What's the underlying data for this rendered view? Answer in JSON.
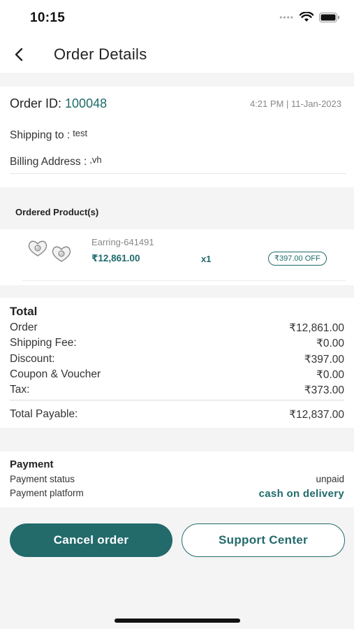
{
  "status_bar": {
    "time": "10:15"
  },
  "header": {
    "title": "Order Details"
  },
  "order": {
    "id_label": "Order ID:",
    "id_value": "100048",
    "datetime": "4:21 PM | 11-Jan-2023",
    "shipping_label": "Shipping to :",
    "shipping_value": "test",
    "billing_label": "Billing Address :",
    "billing_value": ",vh"
  },
  "products": {
    "section_label": "Ordered Product(s)",
    "items": [
      {
        "name": "Earring-641491",
        "price": "₹12,861.00",
        "qty": "x1",
        "discount_badge": "₹397.00 OFF"
      }
    ]
  },
  "totals": {
    "title": "Total",
    "rows": [
      {
        "label": "Order",
        "value": "₹12,861.00"
      },
      {
        "label": "Shipping Fee:",
        "value": "₹0.00"
      },
      {
        "label": "Discount:",
        "value": "₹397.00"
      },
      {
        "label": "Coupon & Voucher",
        "value": "₹0.00"
      },
      {
        "label": "Tax:",
        "value": "₹373.00"
      }
    ],
    "payable_label": "Total Payable:",
    "payable_value": "₹12,837.00"
  },
  "payment": {
    "title": "Payment",
    "status_label": "Payment status",
    "status_value": "unpaid",
    "platform_label": "Payment platform",
    "platform_value": "cash on delivery"
  },
  "actions": {
    "cancel_label": "Cancel order",
    "support_label": "Support Center"
  },
  "colors": {
    "accent": "#1f6b6b",
    "button": "#236a6b",
    "background": "#f4f4f4"
  }
}
